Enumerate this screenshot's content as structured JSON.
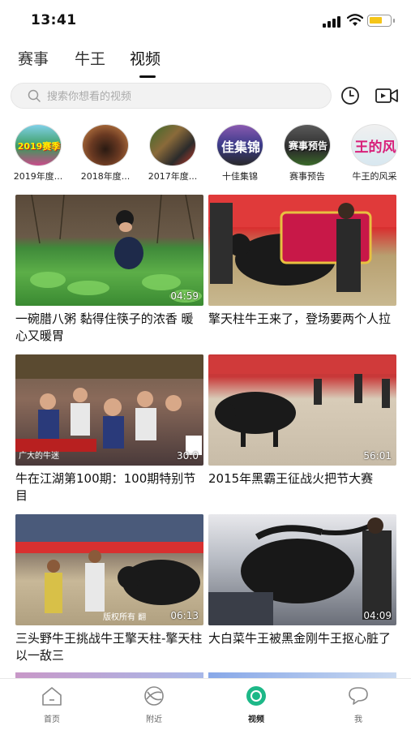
{
  "status_bar": {
    "time": "13:41",
    "battery_color": "#f5c518"
  },
  "top_tabs": [
    {
      "label": "赛事"
    },
    {
      "label": "牛王"
    },
    {
      "label": "视频",
      "active": true
    }
  ],
  "search": {
    "placeholder": "搜索你想看的视频",
    "icon": "search-icon"
  },
  "header_icons": [
    "history-icon",
    "video-camera-icon"
  ],
  "categories": [
    {
      "label": "2019年度...",
      "circle_text": "2019赛季"
    },
    {
      "label": "2018年度..."
    },
    {
      "label": "2017年度..."
    },
    {
      "label": "十佳集锦",
      "circle_text": "佳集锦"
    },
    {
      "label": "赛事预告",
      "circle_text": "赛事预告"
    },
    {
      "label": "牛王的风采",
      "circle_text": "王的风"
    }
  ],
  "videos": [
    {
      "title": "一碗腊八粥 黏得住筷子的浓香 暖心又暖胃",
      "duration": "04:59"
    },
    {
      "title": "擎天柱牛王来了，登场要两个人拉",
      "duration": ""
    },
    {
      "title": "牛在江湖第100期：100期特别节目",
      "duration": "30:0",
      "overlay_text": "广大的牛迷"
    },
    {
      "title": "2015年黑霸王征战火把节大赛",
      "duration": "56:01"
    },
    {
      "title": "三头野牛王挑战牛王擎天柱-擎天柱以一敌三",
      "duration": "06:13",
      "overlay_text": "版权所有 翻"
    },
    {
      "title": "大白菜牛王被黑金刚牛王抠心脏了",
      "duration": "04:09"
    }
  ],
  "bottom_nav": [
    {
      "label": "首页",
      "icon": "home-icon"
    },
    {
      "label": "附近",
      "icon": "nearby-icon"
    },
    {
      "label": "视频",
      "icon": "video-tab-icon",
      "active": true,
      "accent": "#1db888"
    },
    {
      "label": "我",
      "icon": "chat-icon"
    }
  ]
}
